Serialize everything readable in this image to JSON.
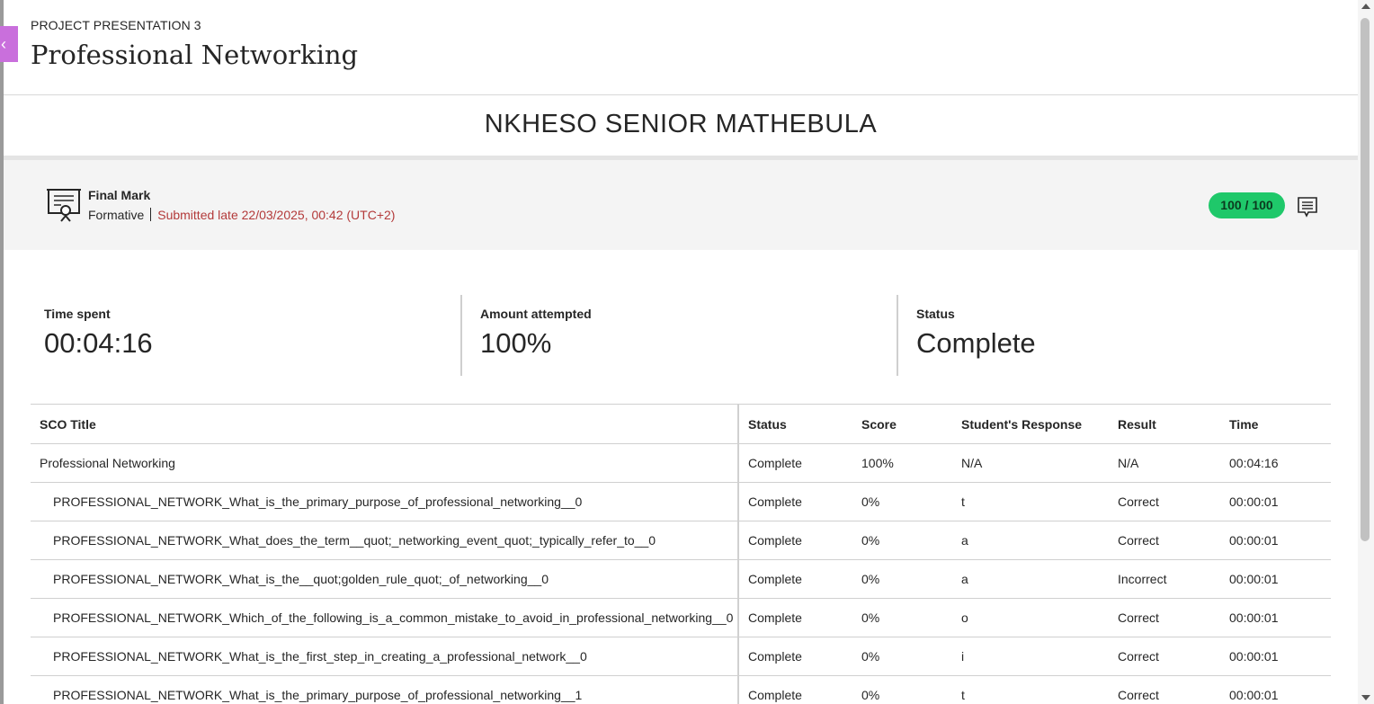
{
  "back_tab": {
    "glyph": "‹"
  },
  "header": {
    "eyebrow": "PROJECT PRESENTATION 3",
    "title": "Professional Networking",
    "student_name": "NKHESO SENIOR MATHEBULA"
  },
  "final_mark": {
    "title": "Final Mark",
    "type": "Formative",
    "submission": "Submitted late 22/03/2025, 00:42 (UTC+2)",
    "score": "100 / 100",
    "score_color": "#1fc86a",
    "late_color": "#b33a3a",
    "icon": "certificate-icon",
    "feedback_icon": "comment-icon"
  },
  "stats": [
    {
      "label": "Time spent",
      "value": "00:04:16"
    },
    {
      "label": "Amount attempted",
      "value": "100%"
    },
    {
      "label": "Status",
      "value": "Complete"
    }
  ],
  "table": {
    "headers": [
      "SCO Title",
      "Status",
      "Score",
      "Student's Response",
      "Result",
      "Time"
    ],
    "rows": [
      [
        "Professional Networking",
        "Complete",
        "100%",
        "N/A",
        "N/A",
        "00:04:16"
      ],
      [
        "PROFESSIONAL_NETWORK_What_is_the_primary_purpose_of_professional_networking__0",
        "Complete",
        "0%",
        "t",
        "Correct",
        "00:00:01"
      ],
      [
        "PROFESSIONAL_NETWORK_What_does_the_term__quot;_networking_event_quot;_typically_refer_to__0",
        "Complete",
        "0%",
        "a",
        "Correct",
        "00:00:01"
      ],
      [
        "PROFESSIONAL_NETWORK_What_is_the__quot;golden_rule_quot;_of_networking__0",
        "Complete",
        "0%",
        "a",
        "Incorrect",
        "00:00:01"
      ],
      [
        "PROFESSIONAL_NETWORK_Which_of_the_following_is_a_common_mistake_to_avoid_in_professional_networking__0",
        "Complete",
        "0%",
        "o",
        "Correct",
        "00:00:01"
      ],
      [
        "PROFESSIONAL_NETWORK_What_is_the_first_step_in_creating_a_professional_network__0",
        "Complete",
        "0%",
        "i",
        "Correct",
        "00:00:01"
      ],
      [
        "PROFESSIONAL_NETWORK_What_is_the_primary_purpose_of_professional_networking__1",
        "Complete",
        "0%",
        "t",
        "Correct",
        "00:00:01"
      ]
    ]
  }
}
